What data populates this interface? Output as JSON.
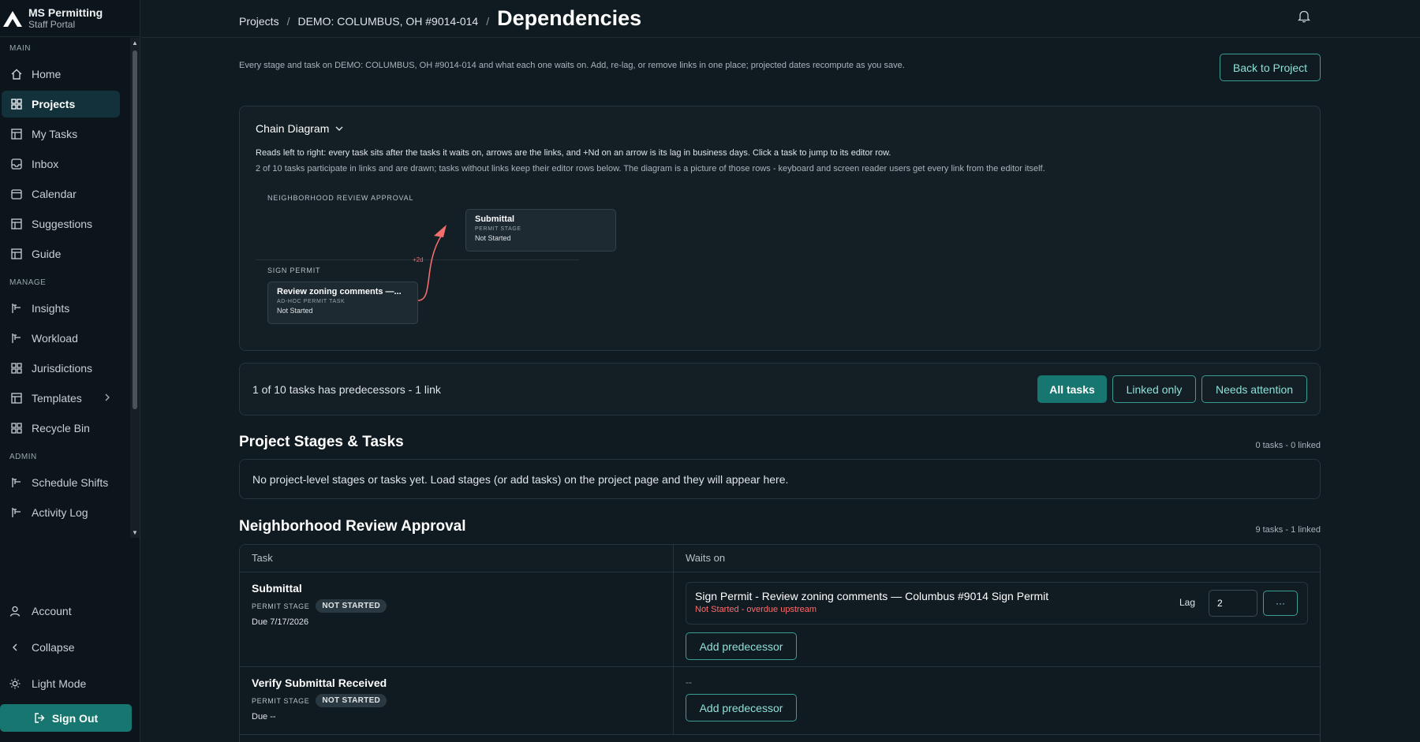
{
  "brand": {
    "title": "MS Permitting",
    "subtitle": "Staff Portal"
  },
  "sidebar": {
    "sections": [
      {
        "label": "MAIN",
        "items": [
          {
            "label": "Home",
            "icon": "home-icon"
          },
          {
            "label": "Projects",
            "icon": "grid-icon",
            "active": true
          },
          {
            "label": "My Tasks",
            "icon": "table-icon"
          },
          {
            "label": "Inbox",
            "icon": "inbox-icon"
          },
          {
            "label": "Calendar",
            "icon": "calendar-icon"
          },
          {
            "label": "Suggestions",
            "icon": "table-icon"
          },
          {
            "label": "Guide",
            "icon": "table-icon"
          }
        ]
      },
      {
        "label": "MANAGE",
        "items": [
          {
            "label": "Insights",
            "icon": "chart-icon"
          },
          {
            "label": "Workload",
            "icon": "chart-icon"
          },
          {
            "label": "Jurisdictions",
            "icon": "grid-icon"
          },
          {
            "label": "Templates",
            "icon": "table-icon",
            "expandable": true
          },
          {
            "label": "Recycle Bin",
            "icon": "grid-icon"
          }
        ]
      },
      {
        "label": "ADMIN",
        "items": [
          {
            "label": "Schedule Shifts",
            "icon": "chart-icon"
          },
          {
            "label": "Activity Log",
            "icon": "chart-icon"
          }
        ]
      }
    ],
    "bottom": {
      "account": "Account",
      "collapse": "Collapse",
      "light_mode": "Light Mode",
      "sign_out": "Sign Out"
    }
  },
  "header": {
    "crumb_projects": "Projects",
    "crumb_project": "DEMO: COLUMBUS, OH #9014-014",
    "separator": "/",
    "title": "Dependencies"
  },
  "description": "Every stage and task on DEMO: COLUMBUS, OH #9014-014 and what each one waits on. Add, re-lag, or remove links in one place; projected dates recompute as you save.",
  "back_button": "Back to Project",
  "chain": {
    "title": "Chain Diagram",
    "line1": "Reads left to right: every task sits after the tasks it waits on, arrows are the links, and +Nd on an arrow is its lag in business days. Click a task to jump to its editor row.",
    "line2": "2 of 10 tasks participate in links and are drawn; tasks without links keep their editor rows below. The diagram is a picture of those rows - keyboard and screen reader users get every link from the editor itself.",
    "lanes": [
      "NEIGHBORHOOD REVIEW APPROVAL",
      "SIGN PERMIT"
    ],
    "nodes": [
      {
        "title": "Submittal",
        "kind": "PERMIT STAGE",
        "status": "Not Started"
      },
      {
        "title": "Review zoning comments —...",
        "kind": "AD-HOC PERMIT TASK",
        "status": "Not Started"
      }
    ],
    "link_label": "+2d",
    "link_color": "#f26d6d"
  },
  "filters": {
    "summary": "1 of 10 tasks has predecessors - 1 link",
    "buttons": [
      "All tasks",
      "Linked only",
      "Needs attention"
    ],
    "active": "All tasks"
  },
  "project_section": {
    "title": "Project Stages & Tasks",
    "count": "0 tasks - 0 linked",
    "empty": "No project-level stages or tasks yet. Load stages (or add tasks) on the project page and they will appear here."
  },
  "neighborhood_section": {
    "title": "Neighborhood Review Approval",
    "count": "9 tasks - 1 linked",
    "columns": [
      "Task",
      "Waits on"
    ],
    "rows": [
      {
        "name": "Submittal",
        "kind": "PERMIT STAGE",
        "status": "NOT STARTED",
        "due": "Due 7/17/2026",
        "predecessor": {
          "title": "Sign Permit - Review zoning comments — Columbus #9014 Sign Permit",
          "warning": "Not Started - overdue upstream",
          "lag_label": "Lag",
          "lag_value": "2",
          "more": "···"
        },
        "add_label": "Add predecessor"
      },
      {
        "name": "Verify Submittal Received",
        "kind": "PERMIT STAGE",
        "status": "NOT STARTED",
        "due": "Due --",
        "empty": "--",
        "add_label": "Add predecessor"
      }
    ]
  },
  "colors": {
    "accent": "#17766f",
    "accent_text": "#8fe0d7",
    "warning": "#ff6b6b",
    "background": "#0f1a21"
  }
}
